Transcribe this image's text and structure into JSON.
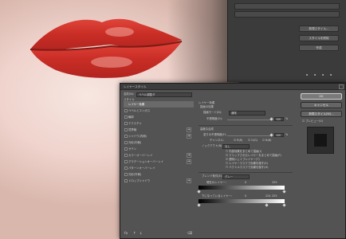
{
  "dialog": {
    "title": "レイヤースタイル",
    "style_label": "スタイル",
    "name_label": "名前(N):",
    "name_value": "ベベル調整ダ",
    "section_title": "レイヤー効果",
    "subsection_title": "描画の効果",
    "blend_mode_label": "描画モード(D):",
    "blend_mode_value": "通常",
    "opacity_label": "不透明度(O):",
    "opacity_value": "100",
    "advanced_title": "高度な合成",
    "fill_opacity_label": "塗りの不透明度(F):",
    "fill_opacity_value": "100",
    "channels_label": "チャンネル:",
    "ch_r": "R(R)",
    "ch_g": "G(G)",
    "ch_b": "B(B)",
    "knockout_label": "ノックアウト(N):",
    "knockout_value": "なし",
    "opt1": "内部効果をまとめて描画(I)",
    "opt2": "クリップされたレイヤーをまとめて描画(P)",
    "opt3": "透明シェイプレイヤー(T)",
    "opt4": "レイヤーマスクで効果を隠す(S)",
    "opt5": "ベクトルマスクで効果を隠す(H)",
    "blend_if_label": "ブレンド条件(E):",
    "blend_if_value": "グレー",
    "this_layer_label": "現在のレイヤー:",
    "this_layer_lo": "0",
    "this_layer_hi": "255",
    "underlying_label": "下になっているレイヤー:",
    "underlying_lo": "0",
    "underlying_mid": "224",
    "underlying_hi": "255",
    "pct": "%"
  },
  "style_items": [
    {
      "label": "レイヤー効果",
      "active": true,
      "check": false,
      "plus": false
    },
    {
      "label": "ベベルとエンボス",
      "active": false,
      "check": true,
      "plus": false
    },
    {
      "label": "輪郭",
      "active": false,
      "check": true,
      "plus": false
    },
    {
      "label": "テクスチャ",
      "active": false,
      "check": true,
      "plus": false
    },
    {
      "label": "境界線",
      "active": false,
      "check": true,
      "plus": true
    },
    {
      "label": "シャドウ(内側)",
      "active": false,
      "check": true,
      "plus": true
    },
    {
      "label": "光彩(内側)",
      "active": false,
      "check": true,
      "plus": false
    },
    {
      "label": "サテン",
      "active": false,
      "check": true,
      "plus": false
    },
    {
      "label": "カラーオーバーレイ",
      "active": false,
      "check": true,
      "plus": true
    },
    {
      "label": "グラデーションオーバーレイ",
      "active": false,
      "check": true,
      "plus": true
    },
    {
      "label": "パターンオーバーレイ",
      "active": false,
      "check": true,
      "plus": false
    },
    {
      "label": "光彩(外側)",
      "active": false,
      "check": true,
      "plus": false
    },
    {
      "label": "ドロップシャドウ",
      "active": false,
      "check": true,
      "plus": true
    }
  ],
  "footer_icons": [
    "fx-icon",
    "up-arrow-icon",
    "down-arrow-icon",
    "trash-icon"
  ],
  "buttons": {
    "ok": "OK",
    "cancel": "キャンセル",
    "new_style": "新規スタイル(W)...",
    "preview": "プレビュー(V)"
  },
  "bg_panel": {
    "btn1": "新規スタイル...",
    "btn2": "スタイルを削除",
    "btn3": "作成"
  },
  "colors": {
    "lip": "#d8342c",
    "dialog_bg": "#535353",
    "panel_bg": "#3b3b3b"
  }
}
